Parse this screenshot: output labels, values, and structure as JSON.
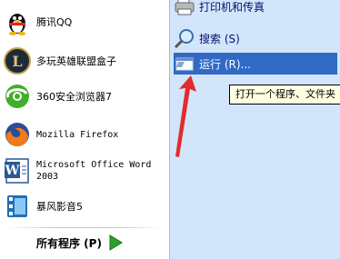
{
  "programs": [
    {
      "label": "腾讯QQ",
      "icon": "qq-penguin-icon"
    },
    {
      "label": "多玩英雄联盟盒子",
      "icon": "league-of-legends-box-icon"
    },
    {
      "label": "360安全浏览器7",
      "icon": "360-browser-icon"
    },
    {
      "label": "Mozilla Firefox",
      "icon": "firefox-icon"
    },
    {
      "label_line1": "Microsoft Office Word",
      "label_line2": "2003",
      "icon": "word-icon"
    },
    {
      "label": "暴风影音5",
      "icon": "baofeng-player-icon"
    }
  ],
  "all_programs": {
    "label": "所有程序 (P)",
    "icon": "green-arrow-icon"
  },
  "right_items": {
    "printers": {
      "label": "打印机和传真",
      "icon": "printer-icon"
    },
    "search": {
      "label": "搜索 (S)",
      "icon": "search-magnifier-icon"
    },
    "run": {
      "label": "运行 (R)...",
      "icon": "run-icon"
    }
  },
  "tooltip": {
    "text": "打开一个程序、文件夹"
  },
  "colors": {
    "right_panel": "#d3e5fa",
    "selected": "#316ac5",
    "tooltip_bg": "#ffffe1",
    "annotation_arrow": "#e32b2b"
  }
}
